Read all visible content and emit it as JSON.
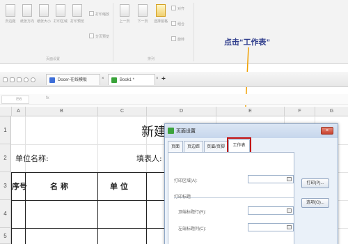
{
  "ribbon": {
    "buttons": [
      "页边距",
      "纸张方向",
      "纸张大小",
      "打印区域",
      "打印预览"
    ],
    "print_scaling_label": "打印缩放",
    "show_pagebreak_label": "分页预览",
    "prev_page_label": "上一页",
    "next_page_label": "下一页",
    "select_pane_label": "选择窗格",
    "align_label": "对齐",
    "group_label": "组合",
    "rotate_label": "旋转",
    "group_page_setup": "页面设置",
    "group_arrange": "排列"
  },
  "annotation": {
    "text": "点击“工作表”"
  },
  "tabs": [
    {
      "label": "Docer-在线模板",
      "color": "#3d6ed8"
    },
    {
      "label": "Book1 *",
      "color": "#3aa33a"
    }
  ],
  "namebox": "I56",
  "formula_fx": "fx",
  "columns": [
    "A",
    "B",
    "C",
    "D",
    "E",
    "F",
    "G"
  ],
  "rows": [
    "1",
    "2",
    "3",
    "4",
    "5"
  ],
  "sheet": {
    "title_partial": "新建纟",
    "unit_name_label": "单位名称:",
    "filler_label": "填表人:",
    "col_seq": "序号",
    "col_name": "名 称",
    "col_unit": "单 位"
  },
  "dialog": {
    "title": "页面设置",
    "close": "×",
    "tabs": [
      "页面",
      "页边距",
      "页眉/页脚",
      "工作表"
    ],
    "active_tab": "工作表",
    "print_area_label": "打印区域(A):",
    "print_titles_label": "打印标题",
    "top_rows_label": "顶端标题行(R):",
    "left_cols_label": "左端标题列(C):",
    "print_button": "打印(P)...",
    "options_button": "选项(O)..."
  },
  "colors": {
    "highlight": "#c00d0d",
    "arrow": "#f0a000",
    "annotation": "#2f3d8c"
  }
}
